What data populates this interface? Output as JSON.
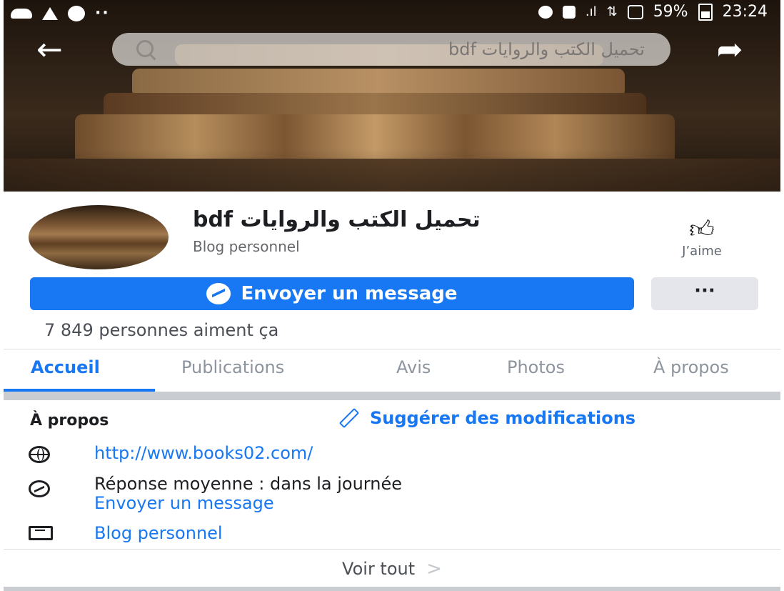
{
  "status_bar": {
    "battery": "59%",
    "time": "23:24"
  },
  "search": {
    "query": "تحميل الكتب والروايات bdf"
  },
  "page": {
    "name": "bdf تحميل الكتب والروايات",
    "category": "Blog personnel",
    "like_label": "J’aime",
    "message_button": "Envoyer un message",
    "more_button": "···",
    "likes_count": "7 849 personnes aiment ça"
  },
  "tabs": [
    {
      "label": "Accueil",
      "active": true
    },
    {
      "label": "Publications",
      "active": false
    },
    {
      "label": "Avis",
      "active": false
    },
    {
      "label": "Photos",
      "active": false
    },
    {
      "label": "À propos",
      "active": false
    }
  ],
  "about": {
    "title": "À propos",
    "suggest_edits": "Suggérer des modifications",
    "website": "http://www.books02.com/",
    "response_time": "Réponse moyenne : dans la journée",
    "send_message": "Envoyer un message",
    "category": "Blog personnel",
    "see_all": "Voir tout"
  },
  "colors": {
    "accent": "#1877f2",
    "secondary_button": "#e4e6eb",
    "text": "#1c1e21",
    "muted": "#65676b"
  }
}
